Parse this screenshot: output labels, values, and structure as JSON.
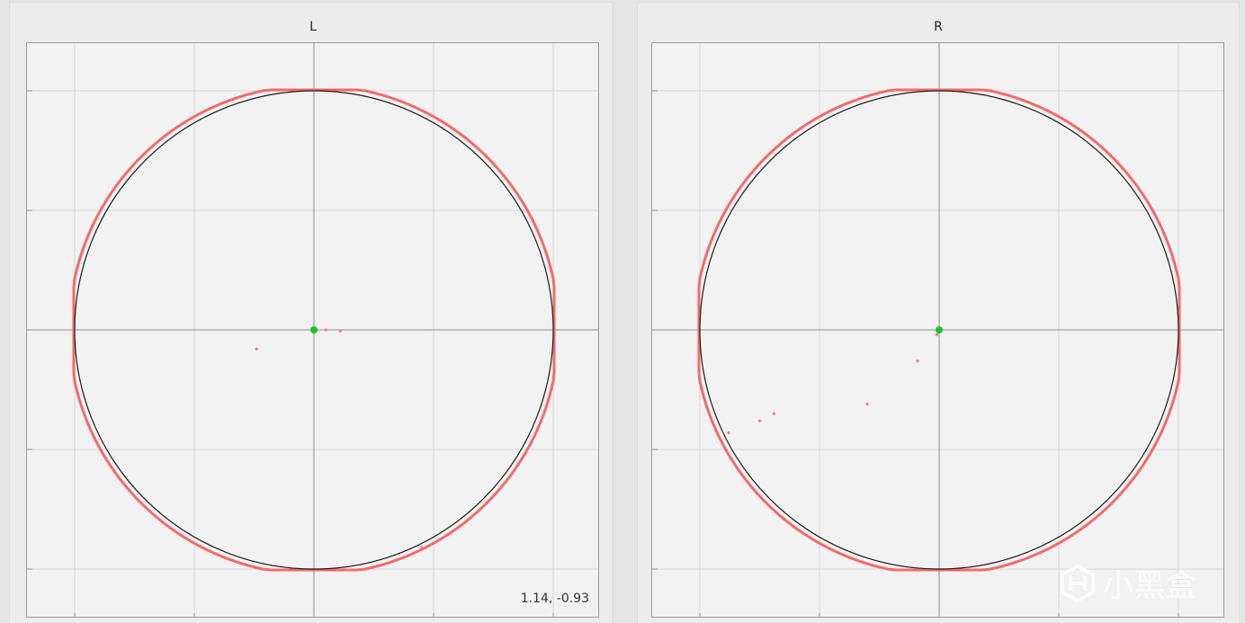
{
  "plots": [
    {
      "id": "left",
      "title": "L",
      "readout": "1.14, -0.93",
      "stick_point": [
        0,
        0
      ],
      "samples": [
        [
          -0.24,
          -0.08
        ],
        [
          0.05,
          0.0
        ],
        [
          0.11,
          -0.005
        ],
        [
          0.45,
          -0.91
        ]
      ]
    },
    {
      "id": "right",
      "title": "R",
      "readout": "",
      "stick_point": [
        0,
        0
      ],
      "samples": [
        [
          -0.01,
          -0.02
        ],
        [
          -0.09,
          -0.13
        ],
        [
          -0.3,
          -0.31
        ],
        [
          -0.69,
          -0.35
        ],
        [
          -0.75,
          -0.38
        ],
        [
          -0.88,
          -0.43
        ]
      ]
    }
  ],
  "colors": {
    "background": "#f2f2f2",
    "grid": "#d6d6d6",
    "axis": "#8c8c8c",
    "circle": "#1a1a1a",
    "gate": "#f26a6a",
    "sample": "#f47a7a",
    "stick": "#1fbf2f"
  },
  "watermark": {
    "text": "小黑盒",
    "icon": "heybox-logo-icon"
  }
}
